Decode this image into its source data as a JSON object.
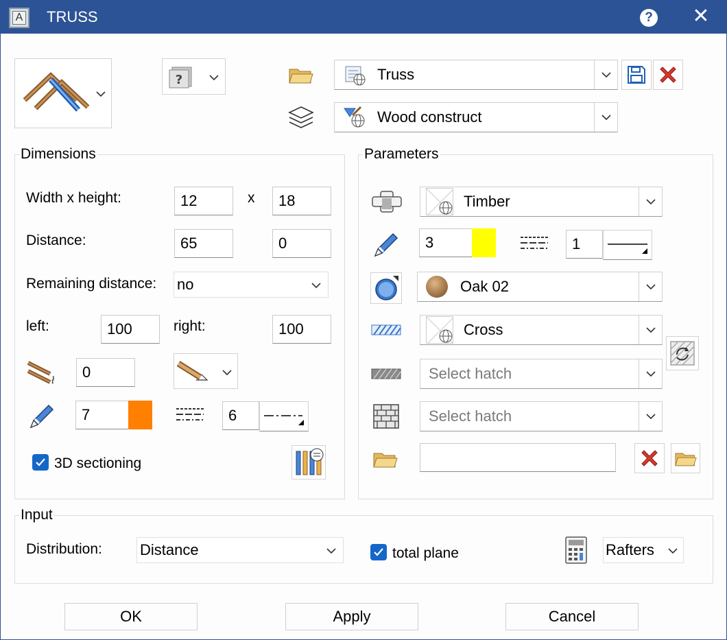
{
  "window": {
    "title": "TRUSS"
  },
  "header": {
    "favorite_value": "Truss",
    "layer_value": "Wood construct"
  },
  "dimensions": {
    "group_title": "Dimensions",
    "width_height_label": "Width x height:",
    "width_value": "12",
    "x_label": "x",
    "height_value": "18",
    "distance_label": "Distance:",
    "distance_value1": "65",
    "distance_value2": "0",
    "remaining_label": "Remaining distance:",
    "remaining_value": "no",
    "left_label": "left:",
    "left_value": "100",
    "right_label": "right:",
    "right_value": "100",
    "offset_value": "0",
    "pen_value": "7",
    "pen_color": "#ff7f00",
    "line_value": "6",
    "sectioning_label": "3D sectioning",
    "sectioning_checked": true
  },
  "parameters": {
    "group_title": "Parameters",
    "material_value": "Timber",
    "pen_value": "3",
    "pen_color": "#ffff00",
    "line_value": "1",
    "surface_value": "Oak 02",
    "hatch1_value": "Cross",
    "hatch2_placeholder": "Select hatch",
    "hatch3_placeholder": "Select hatch",
    "file_value": ""
  },
  "input": {
    "group_title": "Input",
    "distribution_label": "Distribution:",
    "distribution_value": "Distance",
    "total_plane_label": "total plane",
    "total_plane_checked": true,
    "rafters_value": "Rafters"
  },
  "buttons": {
    "ok": "OK",
    "apply": "Apply",
    "cancel": "Cancel"
  }
}
